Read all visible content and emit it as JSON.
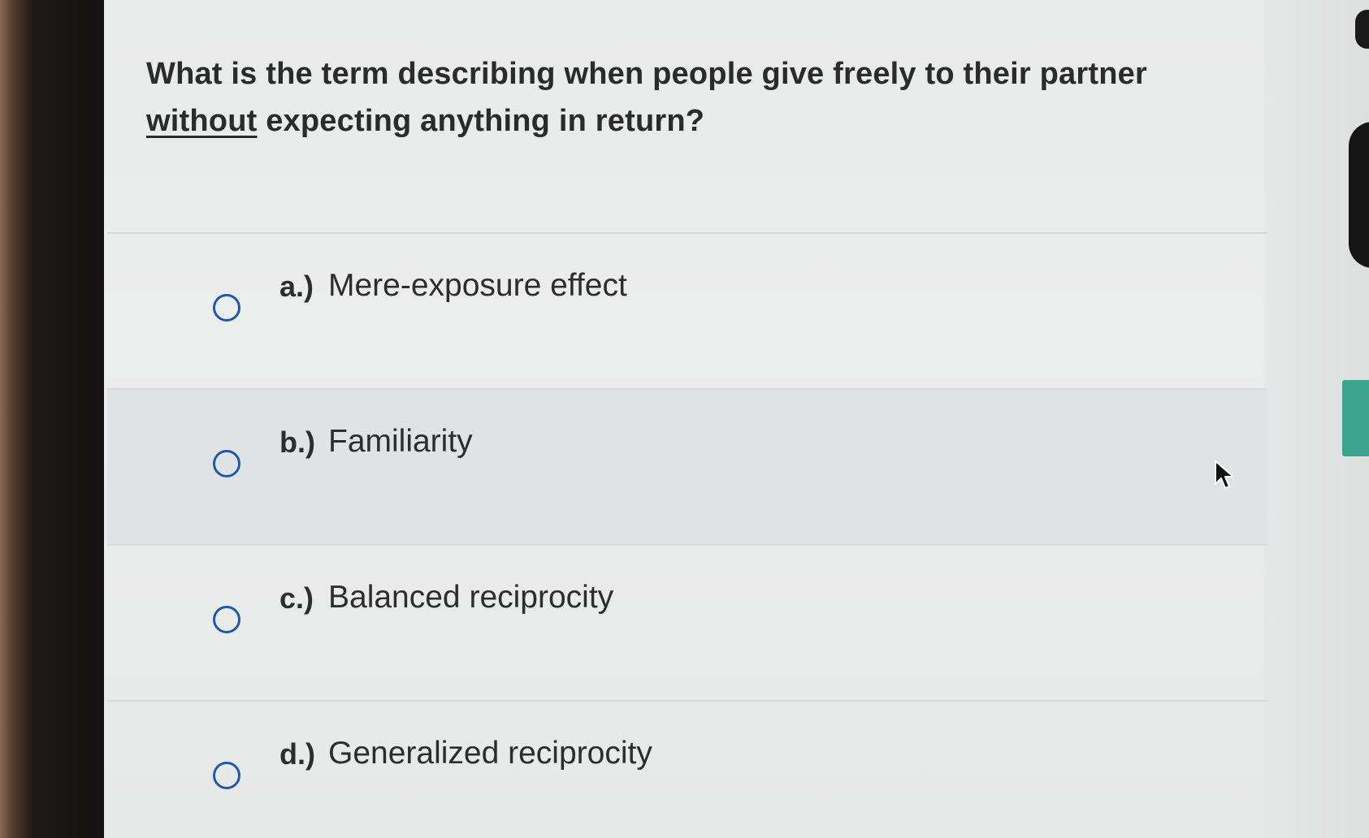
{
  "question": {
    "text_before": "What is the term describing when people give freely to their partner ",
    "underlined": "without",
    "text_after": " expecting anything in return?"
  },
  "options": [
    {
      "letter": "a.)",
      "label": "Mere-exposure effect",
      "selected": false
    },
    {
      "letter": "b.)",
      "label": "Familiarity",
      "selected": false
    },
    {
      "letter": "c.)",
      "label": "Balanced reciprocity",
      "selected": false
    },
    {
      "letter": "d.)",
      "label": "Generalized reciprocity",
      "selected": false
    }
  ],
  "hovered_option_index": 1,
  "colors": {
    "radio_border": "#1f5aa8",
    "hover_background": "#dfe3e5",
    "side_tab": "#3ba58e"
  },
  "icons": {
    "radio": "radio-unchecked-icon",
    "cursor": "mouse-pointer-icon"
  }
}
